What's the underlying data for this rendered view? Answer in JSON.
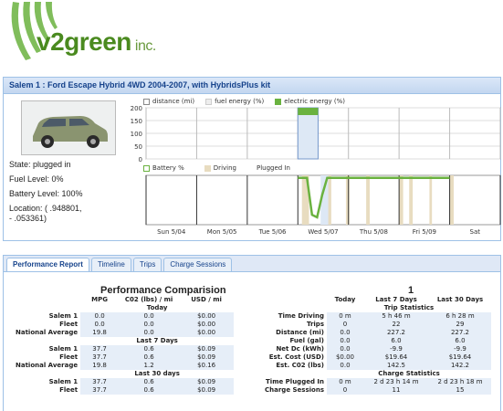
{
  "logo": {
    "brand": "v2green",
    "suffix": "inc."
  },
  "vehicle": {
    "title": "Salem 1 : Ford Escape Hybrid 4WD 2004-2007, with HybridsPlus kit",
    "state_label": "State: plugged in",
    "fuel_label": "Fuel Level: 0%",
    "battery_label": "Battery Level: 100%",
    "location_line1": "Location: (   .948801,",
    "location_line2": "-     .053361)"
  },
  "chart_data": [
    {
      "type": "bar",
      "legend": [
        "distance (mi)",
        "fuel energy (%)",
        "electric energy (%)"
      ],
      "ylim": [
        0,
        200
      ],
      "y_ticks": [
        "200",
        "150",
        "100",
        "50",
        "0"
      ],
      "bars": [
        {
          "start_day": 3.0,
          "end_day": 3.4,
          "distance": 0,
          "fuel": 0,
          "electric": 200
        }
      ]
    },
    {
      "type": "line",
      "legend": [
        "Battery %",
        "Driving",
        "Plugged In"
      ],
      "x_labels": [
        "Sun 5/04",
        "Mon 5/05",
        "Tue 5/06",
        "Wed 5/07",
        "Thu 5/08",
        "Fri 5/09",
        "Sat"
      ],
      "battery_points": [
        [
          3.0,
          95
        ],
        [
          3.18,
          95
        ],
        [
          3.28,
          20
        ],
        [
          3.38,
          15
        ],
        [
          3.48,
          60
        ],
        [
          3.58,
          95
        ],
        [
          6.0,
          95
        ]
      ]
    }
  ],
  "tabs": [
    {
      "label": "Performance Report",
      "active": true
    },
    {
      "label": "Timeline",
      "active": false
    },
    {
      "label": "Trips",
      "active": false
    },
    {
      "label": "Charge Sessions",
      "active": false
    }
  ],
  "perf": {
    "title": "Performance Comparision",
    "headers": [
      "MPG",
      "C02 (lbs) / mi",
      "USD / mi"
    ],
    "sections": [
      {
        "name": "Today",
        "rows": [
          {
            "label": "Salem 1",
            "vals": [
              "0.0",
              "0.0",
              "$0.00"
            ]
          },
          {
            "label": "Fleet",
            "vals": [
              "0.0",
              "0.0",
              "$0.00"
            ]
          },
          {
            "label": "National Average",
            "vals": [
              "19.8",
              "0.0",
              "$0.00"
            ]
          }
        ]
      },
      {
        "name": "Last 7 Days",
        "rows": [
          {
            "label": "Salem 1",
            "vals": [
              "37.7",
              "0.6",
              "$0.09"
            ]
          },
          {
            "label": "Fleet",
            "vals": [
              "37.7",
              "0.6",
              "$0.09"
            ]
          },
          {
            "label": "National Average",
            "vals": [
              "19.8",
              "1.2",
              "$0.16"
            ]
          }
        ]
      },
      {
        "name": "Last 30 days",
        "rows": [
          {
            "label": "Salem 1",
            "vals": [
              "37.7",
              "0.6",
              "$0.09"
            ]
          },
          {
            "label": "Fleet",
            "vals": [
              "37.7",
              "0.6",
              "$0.09"
            ]
          }
        ]
      }
    ]
  },
  "trip": {
    "number": "1",
    "headers": [
      "Today",
      "Last 7 Days",
      "Last 30 Days"
    ],
    "trip_section": "Trip Statistics",
    "charge_section": "Charge Statistics",
    "trip_rows": [
      {
        "label": "Time Driving",
        "vals": [
          "0 m",
          "5 h 46 m",
          "6 h 28 m"
        ]
      },
      {
        "label": "Trips",
        "vals": [
          "0",
          "22",
          "29"
        ]
      },
      {
        "label": "Distance (mi)",
        "vals": [
          "0.0",
          "227.2",
          "227.2"
        ]
      },
      {
        "label": "Fuel (gal)",
        "vals": [
          "0.0",
          "6.0",
          "6.0"
        ]
      },
      {
        "label": "Net Dc (kWh)",
        "vals": [
          "0.0",
          "-9.9",
          "-9.9"
        ]
      },
      {
        "label": "Est. Cost (USD)",
        "vals": [
          "$0.00",
          "$19.64",
          "$19.64"
        ]
      },
      {
        "label": "Est. C02 (lbs)",
        "vals": [
          "0.0",
          "142.5",
          "142.2"
        ]
      }
    ],
    "charge_rows": [
      {
        "label": "Time Plugged In",
        "vals": [
          "0 m",
          "2 d 23 h 14 m",
          "2 d 23 h 18 m"
        ]
      },
      {
        "label": "Charge Sessions",
        "vals": [
          "0",
          "11",
          "15"
        ]
      }
    ]
  },
  "colors": {
    "green": "#6ab23f",
    "dark_green": "#4a8a1f",
    "blue_header": "#15428b",
    "border": "#9ec1e6",
    "tan": "#e8dcc0"
  }
}
